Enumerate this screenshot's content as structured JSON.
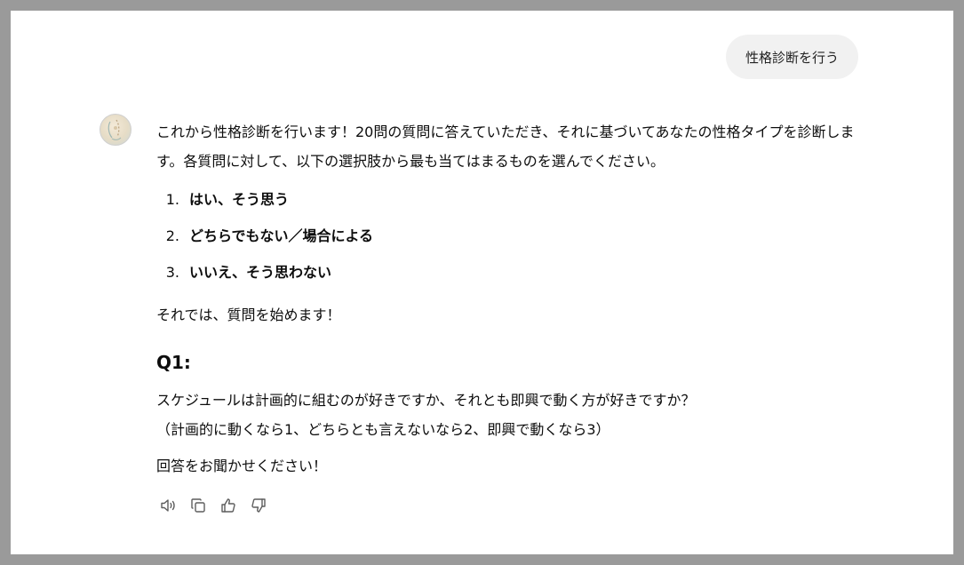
{
  "user_message": "性格診断を行う",
  "assistant": {
    "intro": "これから性格診断を行います！20問の質問に答えていただき、それに基づいてあなたの性格タイプを診断します。各質問に対して、以下の選択肢から最も当てはまるものを選んでください。",
    "options": [
      {
        "num": "1.",
        "text": "はい、そう思う"
      },
      {
        "num": "2.",
        "text": "どちらでもない／場合による"
      },
      {
        "num": "3.",
        "text": "いいえ、そう思わない"
      }
    ],
    "start_text": "それでは、質問を始めます！",
    "question_heading": "Q1:",
    "question_text": "スケジュールは計画的に組むのが好きですか、それとも即興で動く方が好きですか？",
    "question_hint": "（計画的に動くなら1、どちらとも言えないなら2、即興で動くなら3）",
    "closing": "回答をお聞かせください！"
  },
  "actions": [
    {
      "name": "read-aloud-icon"
    },
    {
      "name": "copy-icon"
    },
    {
      "name": "thumbs-up-icon"
    },
    {
      "name": "thumbs-down-icon"
    }
  ]
}
